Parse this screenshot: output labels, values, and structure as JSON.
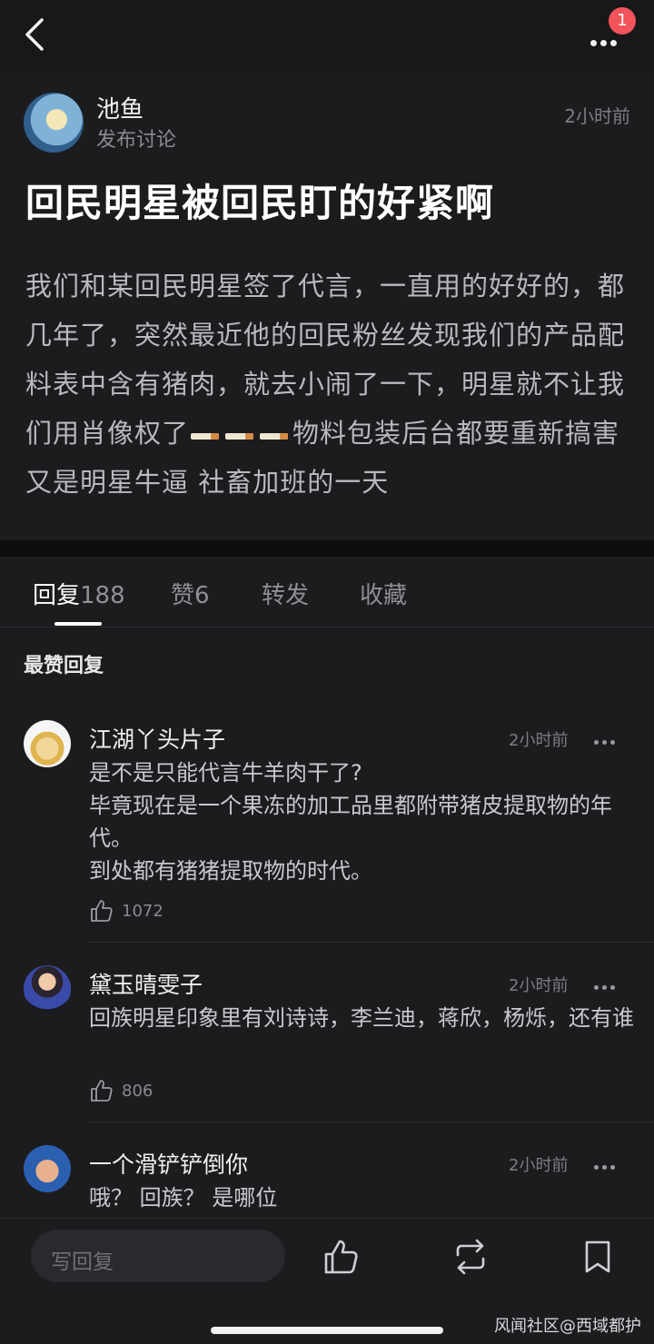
{
  "header": {
    "badge_count": "1"
  },
  "post": {
    "author": "池鱼",
    "author_sub": "发布讨论",
    "time": "2小时前",
    "title": "回民明星被回民盯的好紧啊",
    "body_part1": "我们和某回民明星签了代言，一直用的好好的，都几年了，突然最近他的回民粉丝发现我们的产品配料表中含有猪肉，就去小闹了一下，明星就不让我们用肖像权了",
    "body_part2": "物料包装后台都要重新搞害 又是明星牛逼 社畜加班的一天"
  },
  "tabs": [
    {
      "label": "回复",
      "count": "188"
    },
    {
      "label": "赞",
      "count": "6"
    },
    {
      "label": "转发"
    },
    {
      "label": "收藏"
    }
  ],
  "section_label": "最赞回复",
  "replies": [
    {
      "name": "江湖丫头片子",
      "time": "2小时前",
      "lines": [
        "是不是只能代言牛羊肉干了?",
        "毕竟现在是一个果冻的加工品里都附带猪皮提取物的年代。",
        "到处都有猪猪提取物的时代。"
      ],
      "likes": "1072"
    },
    {
      "name": "黛玉晴雯子",
      "time": "2小时前",
      "lines": [
        "回族明星印象里有刘诗诗，李兰迪，蒋欣，杨烁，还有谁"
      ],
      "likes": "806"
    },
    {
      "name": "一个滑铲铲倒你",
      "time": "2小时前",
      "lines": [
        "哦？ 回族？ 是哪位"
      ]
    }
  ],
  "bottom": {
    "reply_placeholder": "写回复",
    "watermark": "风闻社区@西域都护"
  }
}
